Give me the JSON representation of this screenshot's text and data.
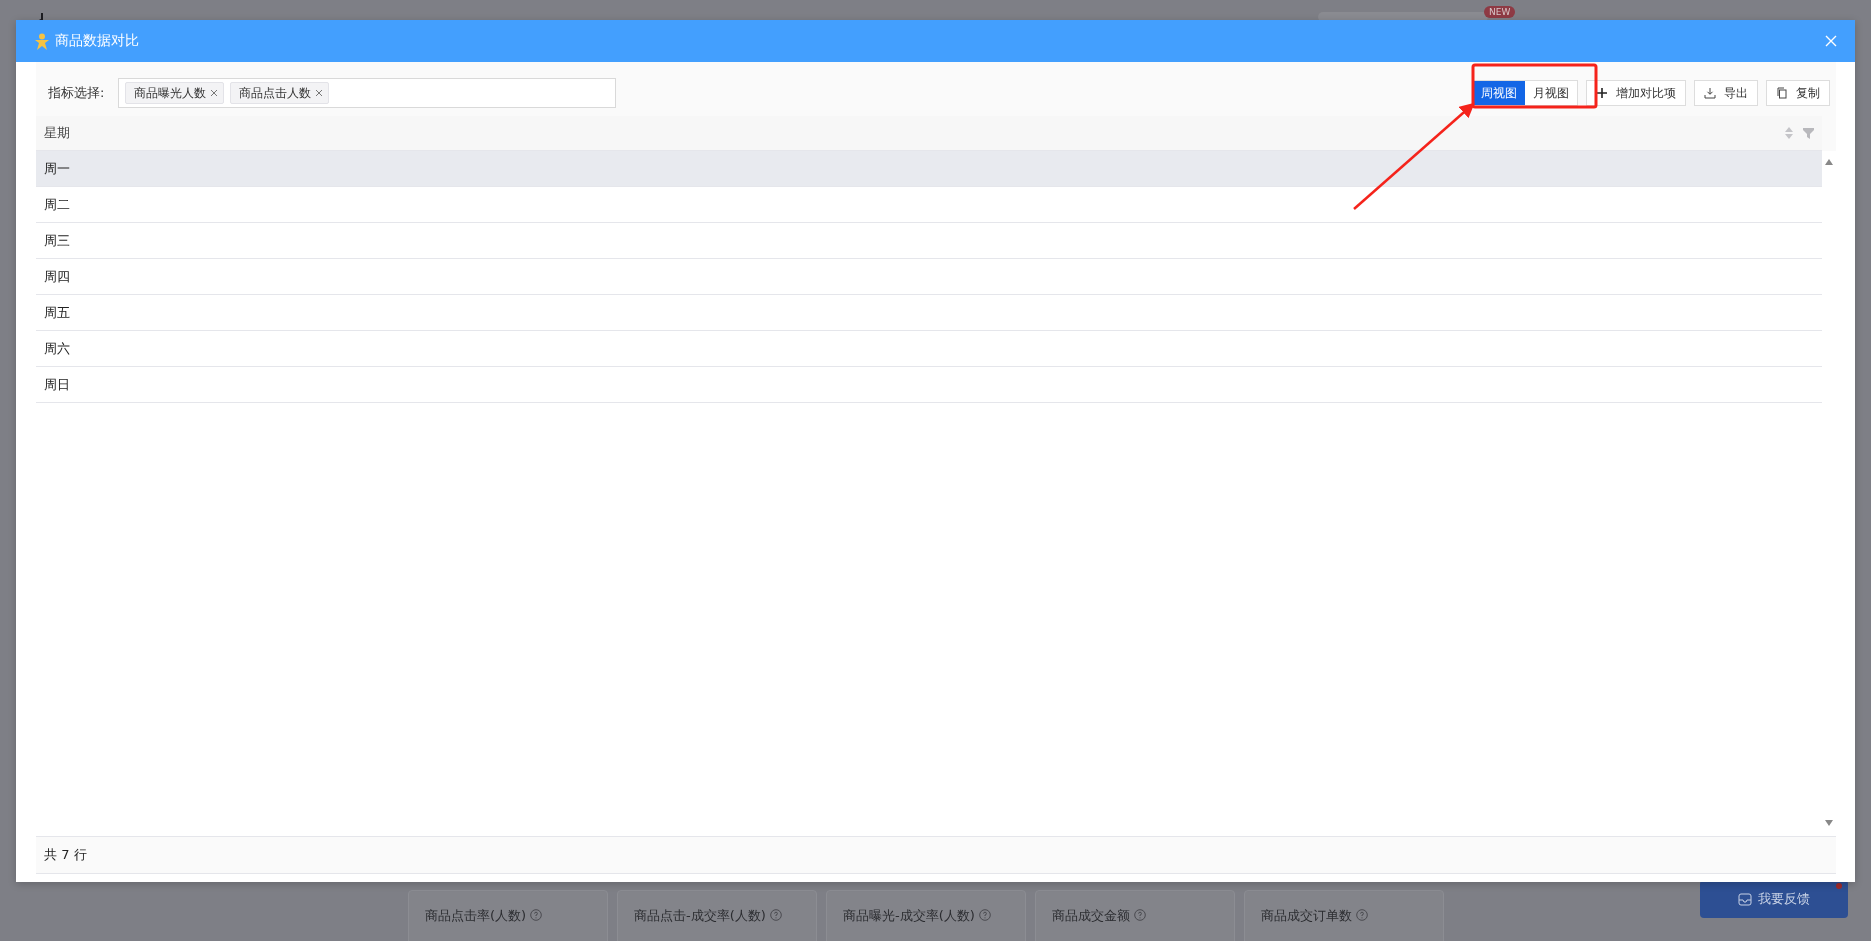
{
  "background": {
    "badge": "NEW",
    "cards": [
      {
        "title": "商品点击率(人数)"
      },
      {
        "title": "商品点击-成交率(人数)"
      },
      {
        "title": "商品曝光-成交率(人数)"
      },
      {
        "title": "商品成交金额"
      },
      {
        "title": "商品成交订单数"
      }
    ],
    "feedback_button": "我要反馈"
  },
  "dialog": {
    "title": "商品数据对比",
    "filter": {
      "label": "指标选择:",
      "tags": [
        "商品曝光人数",
        "商品点击人数"
      ]
    },
    "view_toggle": [
      {
        "label": "周视图",
        "selected": true
      },
      {
        "label": "月视图",
        "selected": false
      }
    ],
    "actions": [
      {
        "kind": "add",
        "label": "增加对比项"
      },
      {
        "kind": "export",
        "label": "导出"
      },
      {
        "kind": "copy",
        "label": "复制"
      }
    ],
    "table": {
      "columns": [
        "星期"
      ],
      "rows": [
        {
          "cells": [
            "周一"
          ],
          "hovered": true
        },
        {
          "cells": [
            "周二"
          ],
          "hovered": false
        },
        {
          "cells": [
            "周三"
          ],
          "hovered": false
        },
        {
          "cells": [
            "周四"
          ],
          "hovered": false
        },
        {
          "cells": [
            "周五"
          ],
          "hovered": false
        },
        {
          "cells": [
            "周六"
          ],
          "hovered": false
        },
        {
          "cells": [
            "周日"
          ],
          "hovered": false
        }
      ]
    },
    "footer": "共 7 行"
  }
}
